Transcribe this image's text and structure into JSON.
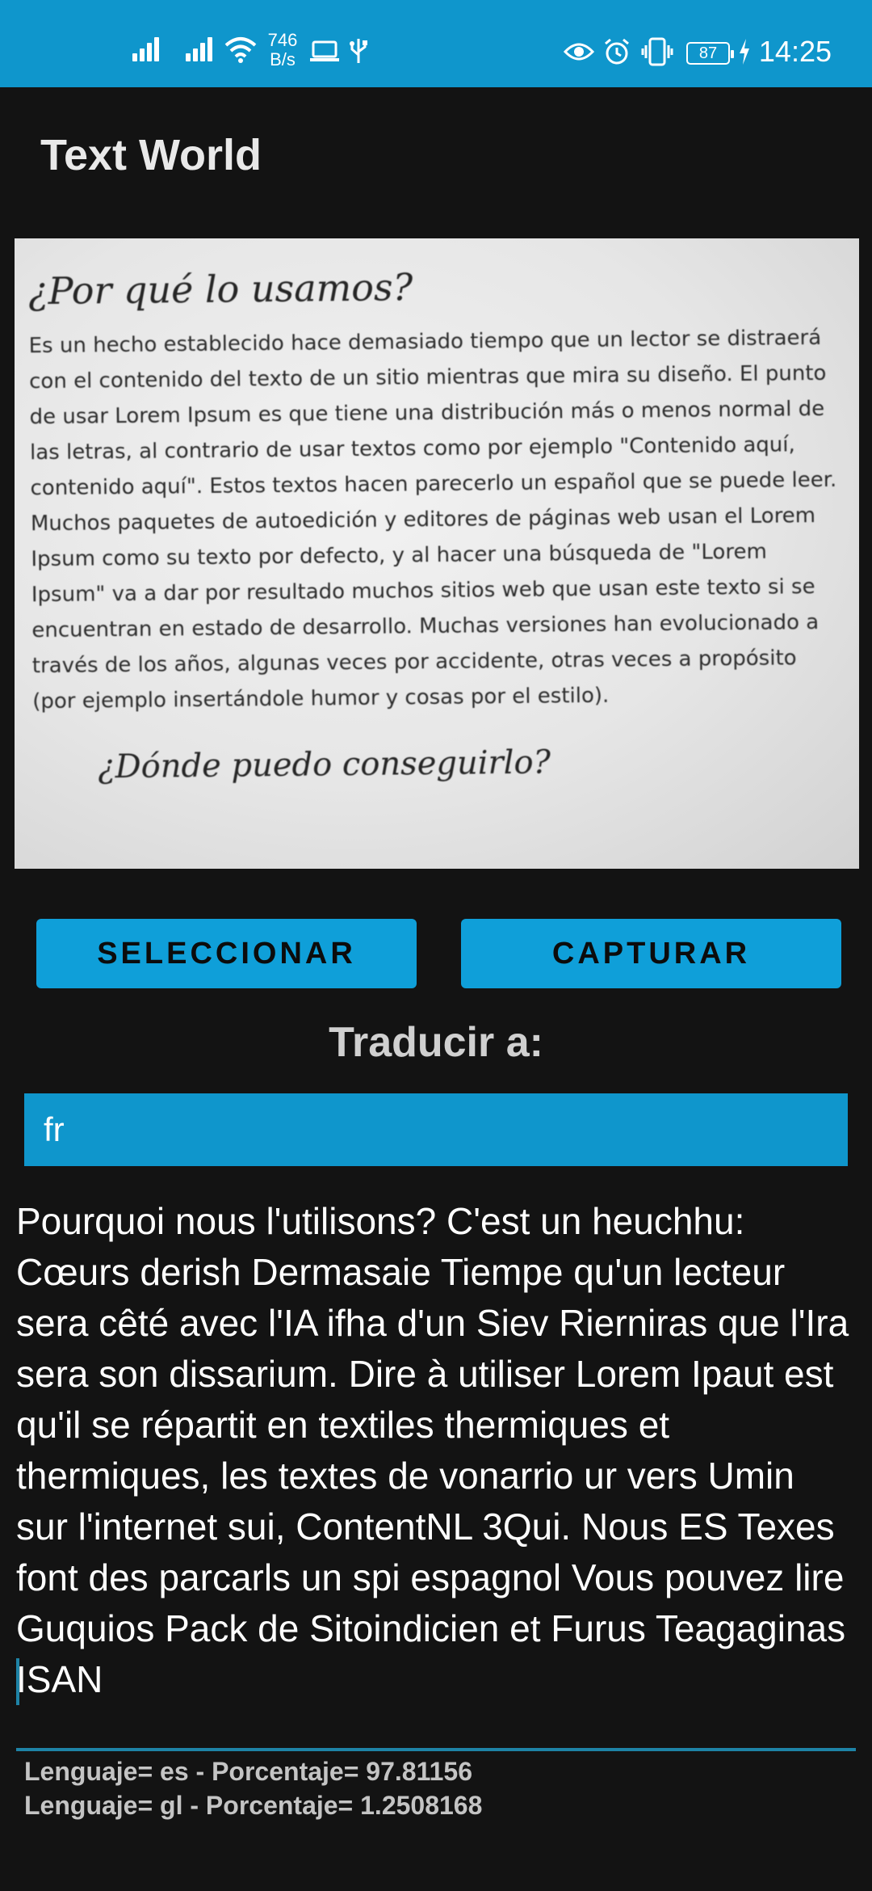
{
  "status_bar": {
    "net_speed_value": "746",
    "net_speed_unit": "B/s",
    "battery": "87",
    "time": "14:25",
    "icons": [
      "signal-icon",
      "signal-icon",
      "wifi-icon",
      "laptop-icon",
      "usb-icon",
      "eye-icon",
      "alarm-icon",
      "vibrate-icon",
      "battery-icon",
      "charging-icon"
    ],
    "background_color": "#0f96cc"
  },
  "app": {
    "title": "Text World"
  },
  "photo": {
    "title": "¿Por qué lo usamos?",
    "body": "Es un hecho establecido hace demasiado tiempo que un lector se distraerá con el contenido del texto de un sitio mientras que mira su diseño. El punto de usar Lorem Ipsum es que tiene una distribución más o menos normal de las letras, al contrario de usar textos como por ejemplo \"Contenido aquí, contenido aquí\". Estos textos hacen parecerlo un español que se puede leer. Muchos paquetes de autoedición y editores de páginas web usan el Lorem Ipsum como su texto por defecto, y al hacer una búsqueda de \"Lorem Ipsum\" va a dar por resultado muchos sitios web que usan este texto si se encuentran en estado de desarrollo. Muchas versiones han evolucionado a través de los años, algunas veces por accidente, otras veces a propósito (por ejemplo insertándole humor y cosas por el estilo).",
    "subtitle": "¿Dónde puedo conseguirlo?"
  },
  "buttons": {
    "select_label": "SELECCIONAR",
    "capture_label": "CAPTURAR",
    "color": "#0f9fd9"
  },
  "translate": {
    "label": "Traducir a:",
    "target_language": "fr"
  },
  "translation": {
    "text": "Pourquoi nous l'utilisons? C'est un heuchhu: Cœurs derish Dermasaie Tiempe qu'un lecteur sera cêté avec l'IA ifha d'un Siev Rierniras que l'Ira sera son dissarium. Dire à utiliser Lorem Ipaut est qu'il se répartit en textiles thermiques et thermiques, les textes de vonarrio ur vers Umin sur l'internet sui, ContentNL 3Qui. Nous ES Texes font des parcarls un spi espagnol Vous pouvez lire Guquios Pack de Sitoindicien et Furus Teagaginas ISAN"
  },
  "detection": [
    "Lenguaje= es - Porcentaje= 97.81156",
    "Lenguaje= gl - Porcentaje= 1.2508168"
  ]
}
